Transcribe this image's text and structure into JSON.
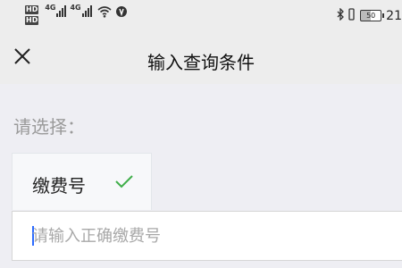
{
  "status_bar": {
    "hd_badge_1": "HD",
    "hd_badge_2": "HD",
    "signal_1_label": "4G",
    "signal_2_label": "4G",
    "battery_level": "50",
    "time": "21"
  },
  "navbar": {
    "title": "输入查询条件",
    "close_icon": "close-icon"
  },
  "form": {
    "choose_label": "请选择：",
    "option": {
      "label": "缴费号",
      "selected": true
    },
    "input": {
      "placeholder": "请输入正确缴费号",
      "value": ""
    }
  },
  "colors": {
    "background": "#eeeef3",
    "navbar": "#ededed",
    "check": "#3fae49",
    "caret": "#2d6bff"
  }
}
